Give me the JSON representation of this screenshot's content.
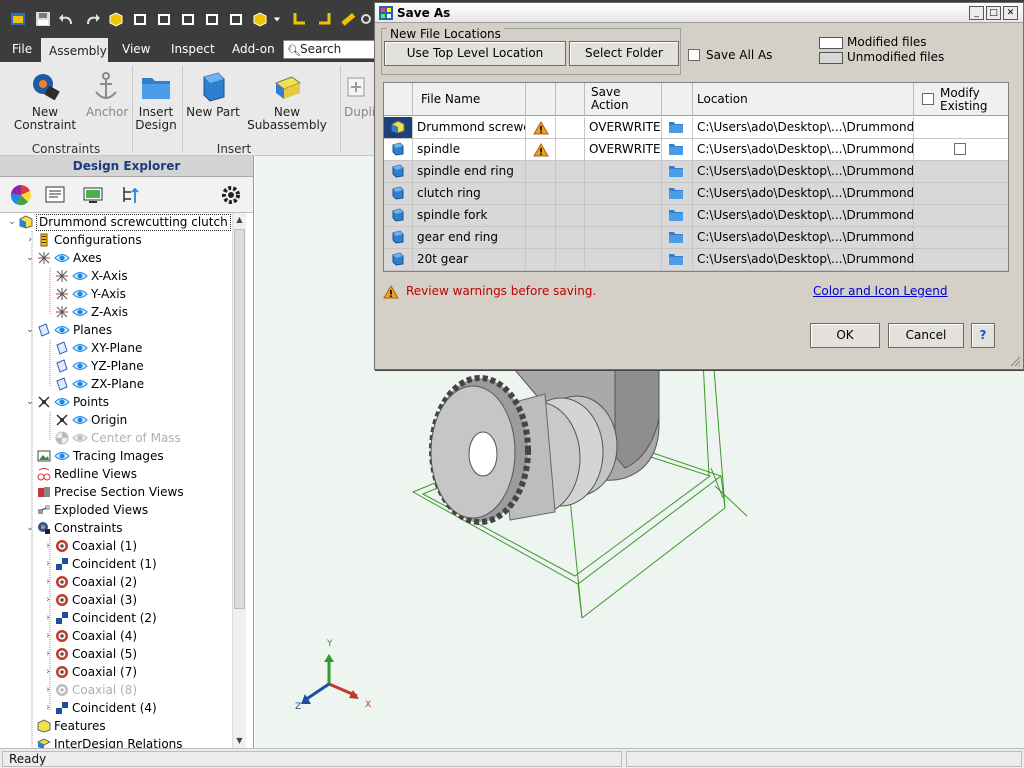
{
  "ribbon": {
    "tabs": [
      {
        "label": "File",
        "active": false
      },
      {
        "label": "Assembly",
        "active": true
      },
      {
        "label": "View",
        "active": false
      },
      {
        "label": "Inspect",
        "active": false
      },
      {
        "label": "Add-on",
        "active": false
      }
    ],
    "search_label": "Search",
    "buttons": {
      "new_constraint": "New Constraint",
      "anchor": "Anchor",
      "insert_design": "Insert\nDesign",
      "new_part": "New Part",
      "new_subassembly": "New Subassembly",
      "duplicate": "Duplic"
    },
    "groups": {
      "constraints": "Constraints",
      "insert": "Insert"
    }
  },
  "explorer": {
    "title": "Design Explorer",
    "tree": [
      {
        "id": "root",
        "label": "Drummond screwcutting clutch",
        "selected": true
      },
      {
        "id": "configurations",
        "label": "Configurations"
      },
      {
        "id": "axes",
        "label": "Axes"
      },
      {
        "id": "x-axis",
        "label": "X-Axis"
      },
      {
        "id": "y-axis",
        "label": "Y-Axis"
      },
      {
        "id": "z-axis",
        "label": "Z-Axis"
      },
      {
        "id": "planes",
        "label": "Planes"
      },
      {
        "id": "xy-plane",
        "label": "XY-Plane"
      },
      {
        "id": "yz-plane",
        "label": "YZ-Plane"
      },
      {
        "id": "zx-plane",
        "label": "ZX-Plane"
      },
      {
        "id": "points",
        "label": "Points"
      },
      {
        "id": "origin",
        "label": "Origin"
      },
      {
        "id": "center-of-mass",
        "label": "Center of Mass",
        "disabled": true
      },
      {
        "id": "tracing-images",
        "label": "Tracing Images"
      },
      {
        "id": "redline-views",
        "label": "Redline Views"
      },
      {
        "id": "precise-section-views",
        "label": "Precise Section Views"
      },
      {
        "id": "exploded-views",
        "label": "Exploded Views"
      },
      {
        "id": "constraints",
        "label": "Constraints"
      },
      {
        "id": "coaxial-1",
        "label": "Coaxial (1)"
      },
      {
        "id": "coincident-1",
        "label": "Coincident (1)"
      },
      {
        "id": "coaxial-2",
        "label": "Coaxial (2)"
      },
      {
        "id": "coaxial-3",
        "label": "Coaxial (3)"
      },
      {
        "id": "coincident-2",
        "label": "Coincident (2)"
      },
      {
        "id": "coaxial-4",
        "label": "Coaxial (4)"
      },
      {
        "id": "coaxial-5",
        "label": "Coaxial (5)"
      },
      {
        "id": "coaxial-7",
        "label": "Coaxial (7)"
      },
      {
        "id": "coaxial-8",
        "label": "Coaxial (8)",
        "disabled": true
      },
      {
        "id": "coincident-4",
        "label": "Coincident (4)"
      },
      {
        "id": "features",
        "label": "Features"
      },
      {
        "id": "interdesign-relations",
        "label": "InterDesign Relations"
      }
    ]
  },
  "viewport": {
    "triad": {
      "x": "X",
      "y": "Y",
      "z": "Z"
    }
  },
  "status": {
    "text": "Ready"
  },
  "dialog": {
    "title": "Save As",
    "new_file_locations_label": "New File Locations",
    "use_top_level_button": "Use Top Level Location",
    "select_folder_button": "Select Folder",
    "save_all_as_label": "Save All As",
    "legend": {
      "modified": "Modified files",
      "unmodified": "Unmodified files"
    },
    "columns": {
      "file_name": "File Name",
      "save_action": "Save\nAction",
      "location": "Location",
      "modify_existing": "Modify\nExisting"
    },
    "rows": [
      {
        "name": "Drummond screwcu...",
        "warning": true,
        "action": "OVERWRITE",
        "location": "C:\\Users\\ado\\Desktop\\...\\Drummond clutch",
        "modify_checkbox": false,
        "modified": true,
        "type": "assembly"
      },
      {
        "name": "spindle",
        "warning": true,
        "action": "OVERWRITE",
        "location": "C:\\Users\\ado\\Desktop\\...\\Drummond clutch",
        "modify_checkbox": true,
        "modified": true,
        "type": "part"
      },
      {
        "name": "spindle end ring",
        "warning": false,
        "action": "",
        "location": "C:\\Users\\ado\\Desktop\\...\\Drummond clutch",
        "modify_checkbox": false,
        "modified": false,
        "type": "part"
      },
      {
        "name": "clutch ring",
        "warning": false,
        "action": "",
        "location": "C:\\Users\\ado\\Desktop\\...\\Drummond clutch",
        "modify_checkbox": false,
        "modified": false,
        "type": "part"
      },
      {
        "name": "spindle fork",
        "warning": false,
        "action": "",
        "location": "C:\\Users\\ado\\Desktop\\...\\Drummond clutch",
        "modify_checkbox": false,
        "modified": false,
        "type": "part"
      },
      {
        "name": "gear end ring",
        "warning": false,
        "action": "",
        "location": "C:\\Users\\ado\\Desktop\\...\\Drummond clutch",
        "modify_checkbox": false,
        "modified": false,
        "type": "part"
      },
      {
        "name": "20t gear",
        "warning": false,
        "action": "",
        "location": "C:\\Users\\ado\\Desktop\\...\\Drummond clutch",
        "modify_checkbox": false,
        "modified": false,
        "type": "part"
      }
    ],
    "warning_message": "Review warnings before saving.",
    "legend_link": "Color and Icon Legend",
    "ok_button": "OK",
    "cancel_button": "Cancel",
    "help_button": "?"
  },
  "colors": {
    "qat_background": "#3c3c3c",
    "ribbon_background": "#e9e9e9",
    "dialog_background": "#d4d0c8",
    "warning_text": "#c00000",
    "link": "#0000cc",
    "sketch_green": "#3a9a2a",
    "part_gray": "#b8b8b8",
    "explorer_title": "#1a3c7a"
  }
}
